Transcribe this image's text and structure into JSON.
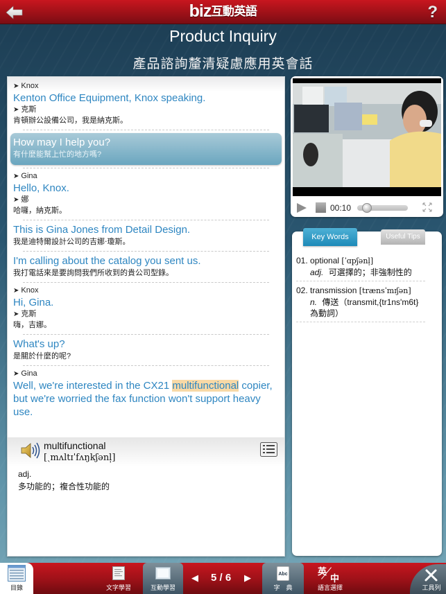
{
  "header": {
    "logo_brand": "biz",
    "logo_cn": "互動英語",
    "help_label": "?",
    "back_icon": "back-arrow-icon"
  },
  "lesson": {
    "title_en": "Product Inquiry",
    "title_cn": "產品諮詢釐清疑慮應用英會話"
  },
  "dialog": {
    "speakers": {
      "knox_en": "Knox",
      "knox_cn": "克斯",
      "gina_en": "Gina",
      "gina_cn": "娜"
    },
    "lines": [
      {
        "en": "Kenton Office Equipment, Knox speaking.",
        "cn": "肯頓辦公設備公司，我是納克斯。"
      },
      {
        "en": "How may I help you?",
        "cn": "有什麼能幫上忙的地方嗎?"
      },
      {
        "en": "Hello, Knox.",
        "cn": "哈囉，納克斯。"
      },
      {
        "en": "This is Gina Jones from Detail Design.",
        "cn": "我是迪特爾設計公司的吉娜‧瓊斯。"
      },
      {
        "en": "I'm calling about the catalog you sent us.",
        "cn": "我打電話來是要詢問我們所收到的貴公司型錄。"
      },
      {
        "en": "Hi, Gina.",
        "cn": "嗨，吉娜。"
      },
      {
        "en": "What's up?",
        "cn": "是關於什麼的呢?"
      },
      {
        "en_before": "Well, we're interested in the CX21 ",
        "en_highlight": "multifunctional",
        "en_after": " copier, but we're worried the fax function won't support heavy use."
      }
    ]
  },
  "dictionary": {
    "word": "multifunctional",
    "ipa": "[ˏmʌltɪˈfʌŋkʃənl̩]",
    "pos": "adj.",
    "definition": "多功能的；複合性功能的"
  },
  "video": {
    "time": "00:10",
    "progress_fraction": 0.12
  },
  "keywords": {
    "tab_active": "Key Words",
    "tab_inactive": "Useful Tips",
    "items": [
      {
        "num": "01.",
        "word": "optional",
        "ipa": "[ˈɑpʃənl̩]",
        "pos": "adj.",
        "def": "可選擇的；非強制性的"
      },
      {
        "num": "02.",
        "word": "transmission",
        "ipa": "[trænsˈmɪʃən]",
        "pos": "n.",
        "def": "傳送（transmit,{tr1ns'm6t}為動詞）"
      }
    ]
  },
  "toolbar": {
    "toc": "目錄",
    "text_study": "文字學習",
    "interactive_study": "互動學習",
    "page": "5 / 6",
    "dictionary": "字　典",
    "dictionary_badge": "Abc",
    "language": "語言選擇",
    "lang_top": "英",
    "lang_bottom": "中",
    "tools": "工具列"
  }
}
